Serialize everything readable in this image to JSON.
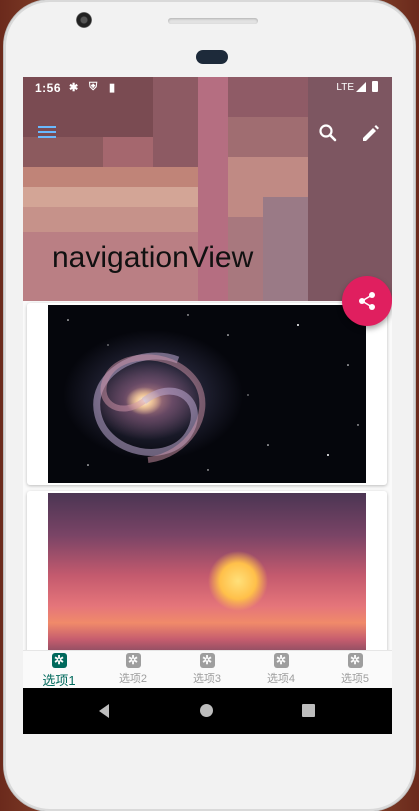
{
  "status_bar": {
    "time": "1:56",
    "network": "LTE",
    "icons": [
      "settings-icon",
      "shield-icon",
      "sd-card-icon",
      "signal-icon",
      "battery-icon"
    ]
  },
  "toolbar": {
    "title": "navigationView",
    "icons": [
      "menu-icon",
      "search-icon",
      "edit-icon"
    ]
  },
  "fab": {
    "icon": "share-icon",
    "color": "#e01f5f"
  },
  "cards": [
    {
      "image": "galaxy-image"
    },
    {
      "image": "sunset-city-image"
    }
  ],
  "bottom_nav": {
    "items": [
      {
        "label": "选项1",
        "icon": "gear-icon",
        "active": true
      },
      {
        "label": "选项2",
        "icon": "gear-icon",
        "active": false
      },
      {
        "label": "选项3",
        "icon": "gear-icon",
        "active": false
      },
      {
        "label": "选项4",
        "icon": "gear-icon",
        "active": false
      },
      {
        "label": "选项5",
        "icon": "gear-icon",
        "active": false
      }
    ],
    "active_color": "#00695c",
    "inactive_color": "#9e9e9e"
  },
  "system_nav": {
    "buttons": [
      "back-button",
      "home-button",
      "recents-button"
    ]
  }
}
